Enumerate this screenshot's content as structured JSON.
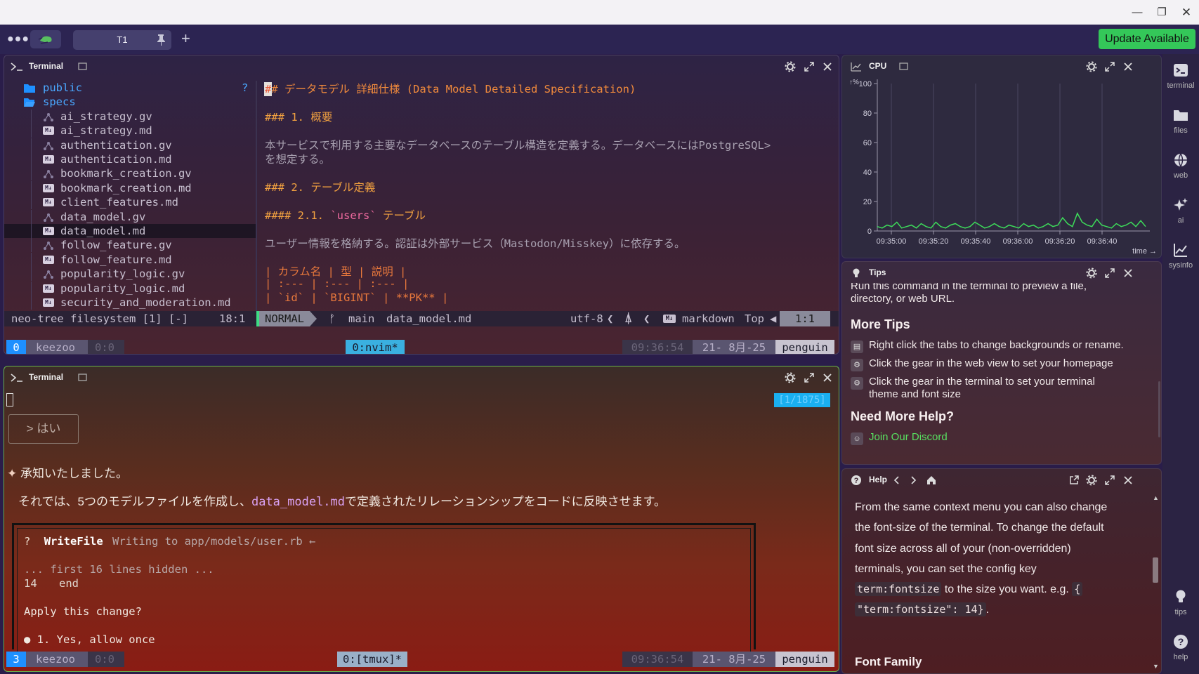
{
  "app": {
    "update_label": "Update Available",
    "tab_label": "T1"
  },
  "sidebar": {
    "items": [
      {
        "label": "terminal",
        "icon": "terminal-icon"
      },
      {
        "label": "files",
        "icon": "folder-icon"
      },
      {
        "label": "web",
        "icon": "globe-icon"
      },
      {
        "label": "ai",
        "icon": "sparkles-icon"
      },
      {
        "label": "sysinfo",
        "icon": "chart-icon"
      },
      {
        "label": "tips",
        "icon": "lightbulb-icon"
      },
      {
        "label": "help",
        "icon": "question-icon"
      }
    ]
  },
  "term1": {
    "title": "Terminal",
    "tree": [
      {
        "name": "public",
        "kind": "folder"
      },
      {
        "name": "specs",
        "kind": "folder-open"
      },
      {
        "name": "ai_strategy.gv",
        "kind": "gv"
      },
      {
        "name": "ai_strategy.md",
        "kind": "md"
      },
      {
        "name": "authentication.gv",
        "kind": "gv"
      },
      {
        "name": "authentication.md",
        "kind": "md"
      },
      {
        "name": "bookmark_creation.gv",
        "kind": "gv"
      },
      {
        "name": "bookmark_creation.md",
        "kind": "md"
      },
      {
        "name": "client_features.md",
        "kind": "md"
      },
      {
        "name": "data_model.gv",
        "kind": "gv"
      },
      {
        "name": "data_model.md",
        "kind": "md"
      },
      {
        "name": "follow_feature.gv",
        "kind": "gv"
      },
      {
        "name": "follow_feature.md",
        "kind": "md"
      },
      {
        "name": "popularity_logic.gv",
        "kind": "gv"
      },
      {
        "name": "popularity_logic.md",
        "kind": "md"
      },
      {
        "name": "security_and_moderation.md",
        "kind": "md"
      }
    ],
    "tree_question": "?",
    "editor": {
      "h2_prefix": "#",
      "h2_rest": "# データモデル 詳細仕様 (Data Model Detailed Specification)",
      "h3_1": "### 1. 概要",
      "para1_a": "本サービスで利用する主要なデータベースのテーブル構造を定義する。データベースにはPostgreSQL>",
      "para1_b": "を想定する。",
      "h3_2": "### 2. テーブル定義",
      "h4_prefix": "#### 2.1. ",
      "h4_code": "`users`",
      "h4_suffix": " テーブル",
      "para2": "ユーザー情報を格納する。認証は外部サービス（Mastodon/Misskey）に依存する。",
      "table_head": "| カラム名 | 型 | 説明 |",
      "table_sep": "| :--- | :--- | :--- |",
      "table_row": "| `id` | `BIGINT` | **PK** |"
    },
    "status": {
      "left": "neo-tree filesystem [1] [-]",
      "pos_left": "18:1",
      "mode": "NORMAL",
      "branch": "main",
      "file": "data_model.md",
      "encoding": "utf-8",
      "filetype": "markdown",
      "scroll": "Top",
      "pos": "1:1"
    },
    "tmux": {
      "index": "0",
      "session": "keezoo",
      "pane": "0:0",
      "window": "0:nvim*",
      "time": "09:36:54",
      "date": "21- 8月-25",
      "host": "penguin"
    }
  },
  "term2": {
    "title": "Terminal",
    "counter": "[1/1875]",
    "choice": "> はい",
    "ack": "承知いたしました。",
    "msg_a": "それでは、5つのモデルファイルを作成し、",
    "msg_code": "data_model.md",
    "msg_b": "で定義されたリレーションシップをコードに反映させます。",
    "tool_q": "?",
    "tool_name": "WriteFile",
    "tool_desc": "Writing to app/models/user.rb ←",
    "hidden": "... first 16 lines hidden ...",
    "line_no": "14",
    "line_code": "end",
    "apply": "Apply this change?",
    "option1": "● 1. Yes, allow once",
    "tmux": {
      "index": "3",
      "session": "keezoo",
      "pane": "0:0",
      "window": "0:[tmux]*",
      "time": "09:36:54",
      "date": "21- 8月-25",
      "host": "penguin"
    }
  },
  "cpu": {
    "title": "CPU",
    "unit_label": "↑%",
    "time_label": "time →"
  },
  "chart_data": {
    "type": "line",
    "title": "CPU",
    "ylabel": "%",
    "xlabel": "time",
    "ylim": [
      0,
      100
    ],
    "yticks": [
      "0",
      "20",
      "40",
      "60",
      "80",
      "100"
    ],
    "xticks": [
      "09:35:00",
      "09:35:20",
      "09:35:40",
      "09:36:00",
      "09:36:20",
      "09:36:40"
    ],
    "x": [
      0,
      2,
      4,
      6,
      8,
      10,
      12,
      14,
      16,
      18,
      20,
      22,
      24,
      26,
      28,
      30,
      32,
      34,
      36,
      38,
      40,
      42,
      44,
      46,
      48,
      50,
      52,
      54,
      56,
      58,
      60,
      62,
      64,
      66,
      68,
      70,
      72,
      74,
      76,
      78,
      80,
      82,
      84,
      86,
      88,
      90,
      92,
      94,
      96,
      98,
      100,
      102,
      104,
      106,
      108,
      110
    ],
    "series": [
      {
        "values": [
          3,
          2,
          4,
          3,
          6,
          2,
          3,
          4,
          2,
          5,
          3,
          2,
          6,
          3,
          2,
          4,
          5,
          3,
          2,
          3,
          6,
          4,
          2,
          3,
          5,
          3,
          2,
          4,
          3,
          2,
          5,
          3,
          4,
          2,
          3,
          5,
          3,
          4,
          9,
          5,
          3,
          12,
          6,
          4,
          3,
          8,
          4,
          3,
          2,
          5,
          3,
          4,
          6,
          3,
          7,
          3
        ]
      }
    ],
    "grid": true,
    "line_color": "#3ddc5a"
  },
  "tips": {
    "title": "Tips",
    "intro_a": "Run this command in the terminal to preview a file,",
    "intro_b": "directory, or web URL.",
    "more_heading": "More Tips",
    "tip1": "Right click the tabs to change backgrounds or rename.",
    "tip2": "Click the gear in the web view to set your homepage",
    "tip3a": "Click the gear in the terminal to set your terminal",
    "tip3b": "theme and font size",
    "help_heading": "Need More Help?",
    "discord": "Join Our Discord"
  },
  "help": {
    "title": "Help",
    "l1": "From the same context menu you can also change",
    "l2": "the font-size of the terminal. To change the default",
    "l3": "font size across all of your (non-overridden)",
    "l4": "terminals, you can set the config key",
    "code1": "term:fontsize",
    "l5b": " to the size you want. e.g. ",
    "code2a": "{",
    "code2b": "\"term:fontsize\": 14}",
    "l6b": ".",
    "section": "Font Family"
  }
}
